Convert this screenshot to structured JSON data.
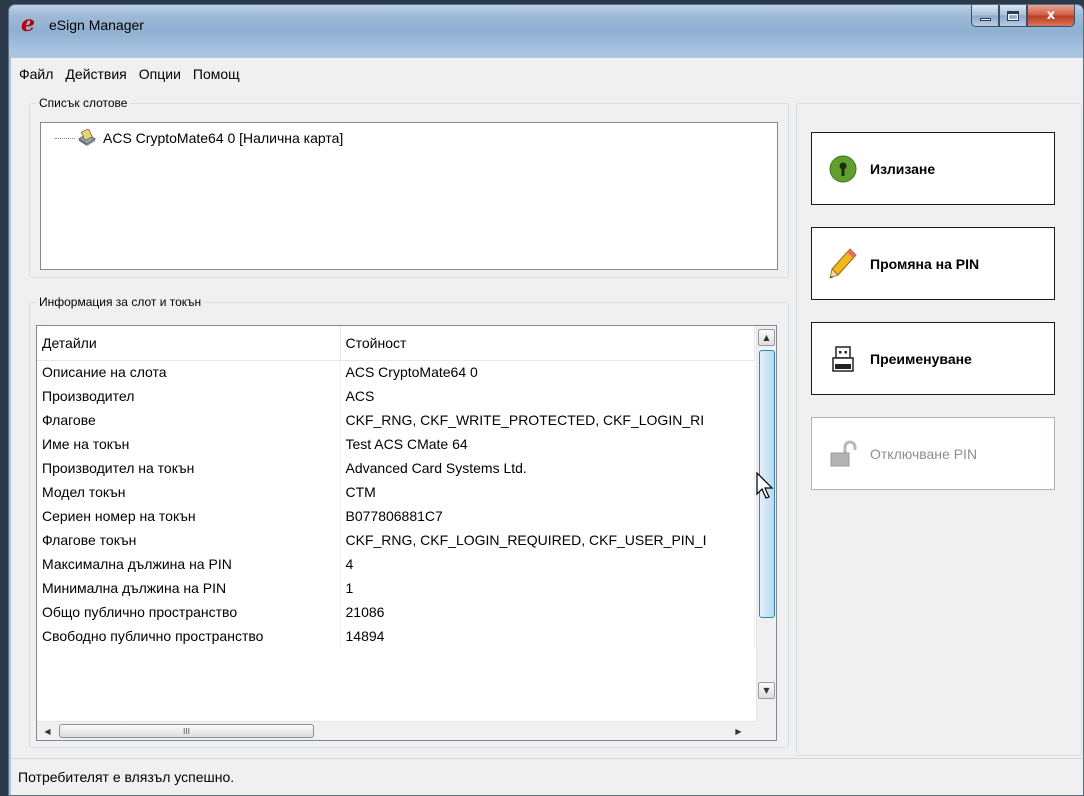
{
  "window": {
    "title": "eSign Manager",
    "close_glyph": "x"
  },
  "menu": [
    "Файл",
    "Действия",
    "Опции",
    "Помощ"
  ],
  "slot_list": {
    "label": "Списък слотове",
    "items": [
      {
        "text": "ACS CryptoMate64 0  [Налична карта]",
        "icon": "card-reader-icon"
      }
    ]
  },
  "info": {
    "label": "Информация за слот и токън",
    "columns": [
      "Детайли",
      "Стойност"
    ],
    "rows": [
      [
        "Описание на слота",
        "ACS CryptoMate64 0"
      ],
      [
        "Производител",
        "ACS"
      ],
      [
        "Флагове",
        "CKF_RNG, CKF_WRITE_PROTECTED, CKF_LOGIN_RI"
      ],
      [
        "Име на токън",
        "Test ACS CMate 64"
      ],
      [
        "Производител на токън",
        "Advanced Card Systems Ltd."
      ],
      [
        "Модел токън",
        "CTM"
      ],
      [
        "Сериен номер на токън",
        "B077806881C7"
      ],
      [
        "Флагове токън",
        "CKF_RNG, CKF_LOGIN_REQUIRED, CKF_USER_PIN_I"
      ],
      [
        "Максимална дължина на PIN",
        "4"
      ],
      [
        "Минимална дължина на PIN",
        "1"
      ],
      [
        "Общо публично пространство",
        "21086"
      ],
      [
        "Свободно публично пространство",
        "14894"
      ]
    ],
    "hscroll_grip": "III"
  },
  "actions": [
    {
      "label": "Излизане",
      "icon": "key-icon",
      "enabled": true
    },
    {
      "label": "Промяна на PIN",
      "icon": "pencil-icon",
      "enabled": true
    },
    {
      "label": "Преименуване",
      "icon": "usb-token-icon",
      "enabled": true
    },
    {
      "label": "Отключване PIN",
      "icon": "unlock-icon",
      "enabled": false
    }
  ],
  "status": "Потребителят е влязъл успешно.",
  "colors": {
    "accent_green": "#5fa02c",
    "pencil_yellow": "#f2b81e",
    "scroll_thumb": "#b7d9f3",
    "close_red": "#c8462c"
  }
}
